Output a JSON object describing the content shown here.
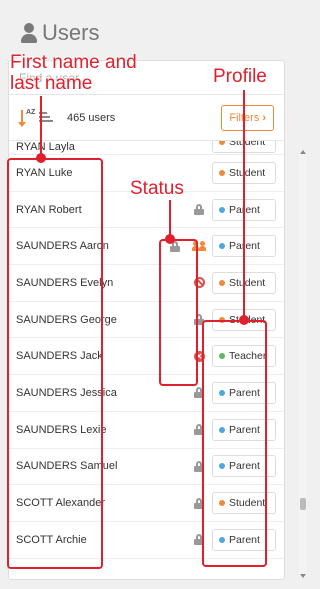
{
  "header": {
    "title": "Users",
    "icon": "user-icon"
  },
  "search": {
    "placeholder": "Find a user",
    "value": ""
  },
  "toolbar": {
    "count_label": "465 users",
    "filters_label": "Filters",
    "sort_label": "AZ"
  },
  "rows": [
    {
      "name": "RYAN Layla",
      "status": "",
      "profile": "Student",
      "color": "#f08a3a"
    },
    {
      "name": "RYAN Luke",
      "status": "",
      "profile": "Student",
      "color": "#f08a3a"
    },
    {
      "name": "RYAN Robert",
      "status": "lock",
      "profile": "Parent",
      "color": "#4aa8e0"
    },
    {
      "name": "SAUNDERS Aaron",
      "status": "lock+people",
      "profile": "Parent",
      "color": "#4aa8e0"
    },
    {
      "name": "SAUNDERS Evelyn",
      "status": "ban",
      "profile": "Student",
      "color": "#f08a3a"
    },
    {
      "name": "SAUNDERS George",
      "status": "lock",
      "profile": "Student",
      "color": "#f08a3a"
    },
    {
      "name": "SAUNDERS Jack",
      "status": "x-circle",
      "profile": "Teacher",
      "color": "#5cb85c"
    },
    {
      "name": "SAUNDERS Jessica",
      "status": "lock",
      "profile": "Parent",
      "color": "#4aa8e0"
    },
    {
      "name": "SAUNDERS Lexie",
      "status": "lock",
      "profile": "Parent",
      "color": "#4aa8e0"
    },
    {
      "name": "SAUNDERS Samuel",
      "status": "lock",
      "profile": "Parent",
      "color": "#4aa8e0"
    },
    {
      "name": "SCOTT Alexander",
      "status": "lock",
      "profile": "Student",
      "color": "#f08a3a"
    },
    {
      "name": "SCOTT Archie",
      "status": "lock",
      "profile": "Parent",
      "color": "#4aa8e0"
    }
  ],
  "annotations": {
    "name_label": "First name and\nlast name",
    "status_label": "Status",
    "profile_label": "Profile",
    "color": "#e0202c"
  }
}
